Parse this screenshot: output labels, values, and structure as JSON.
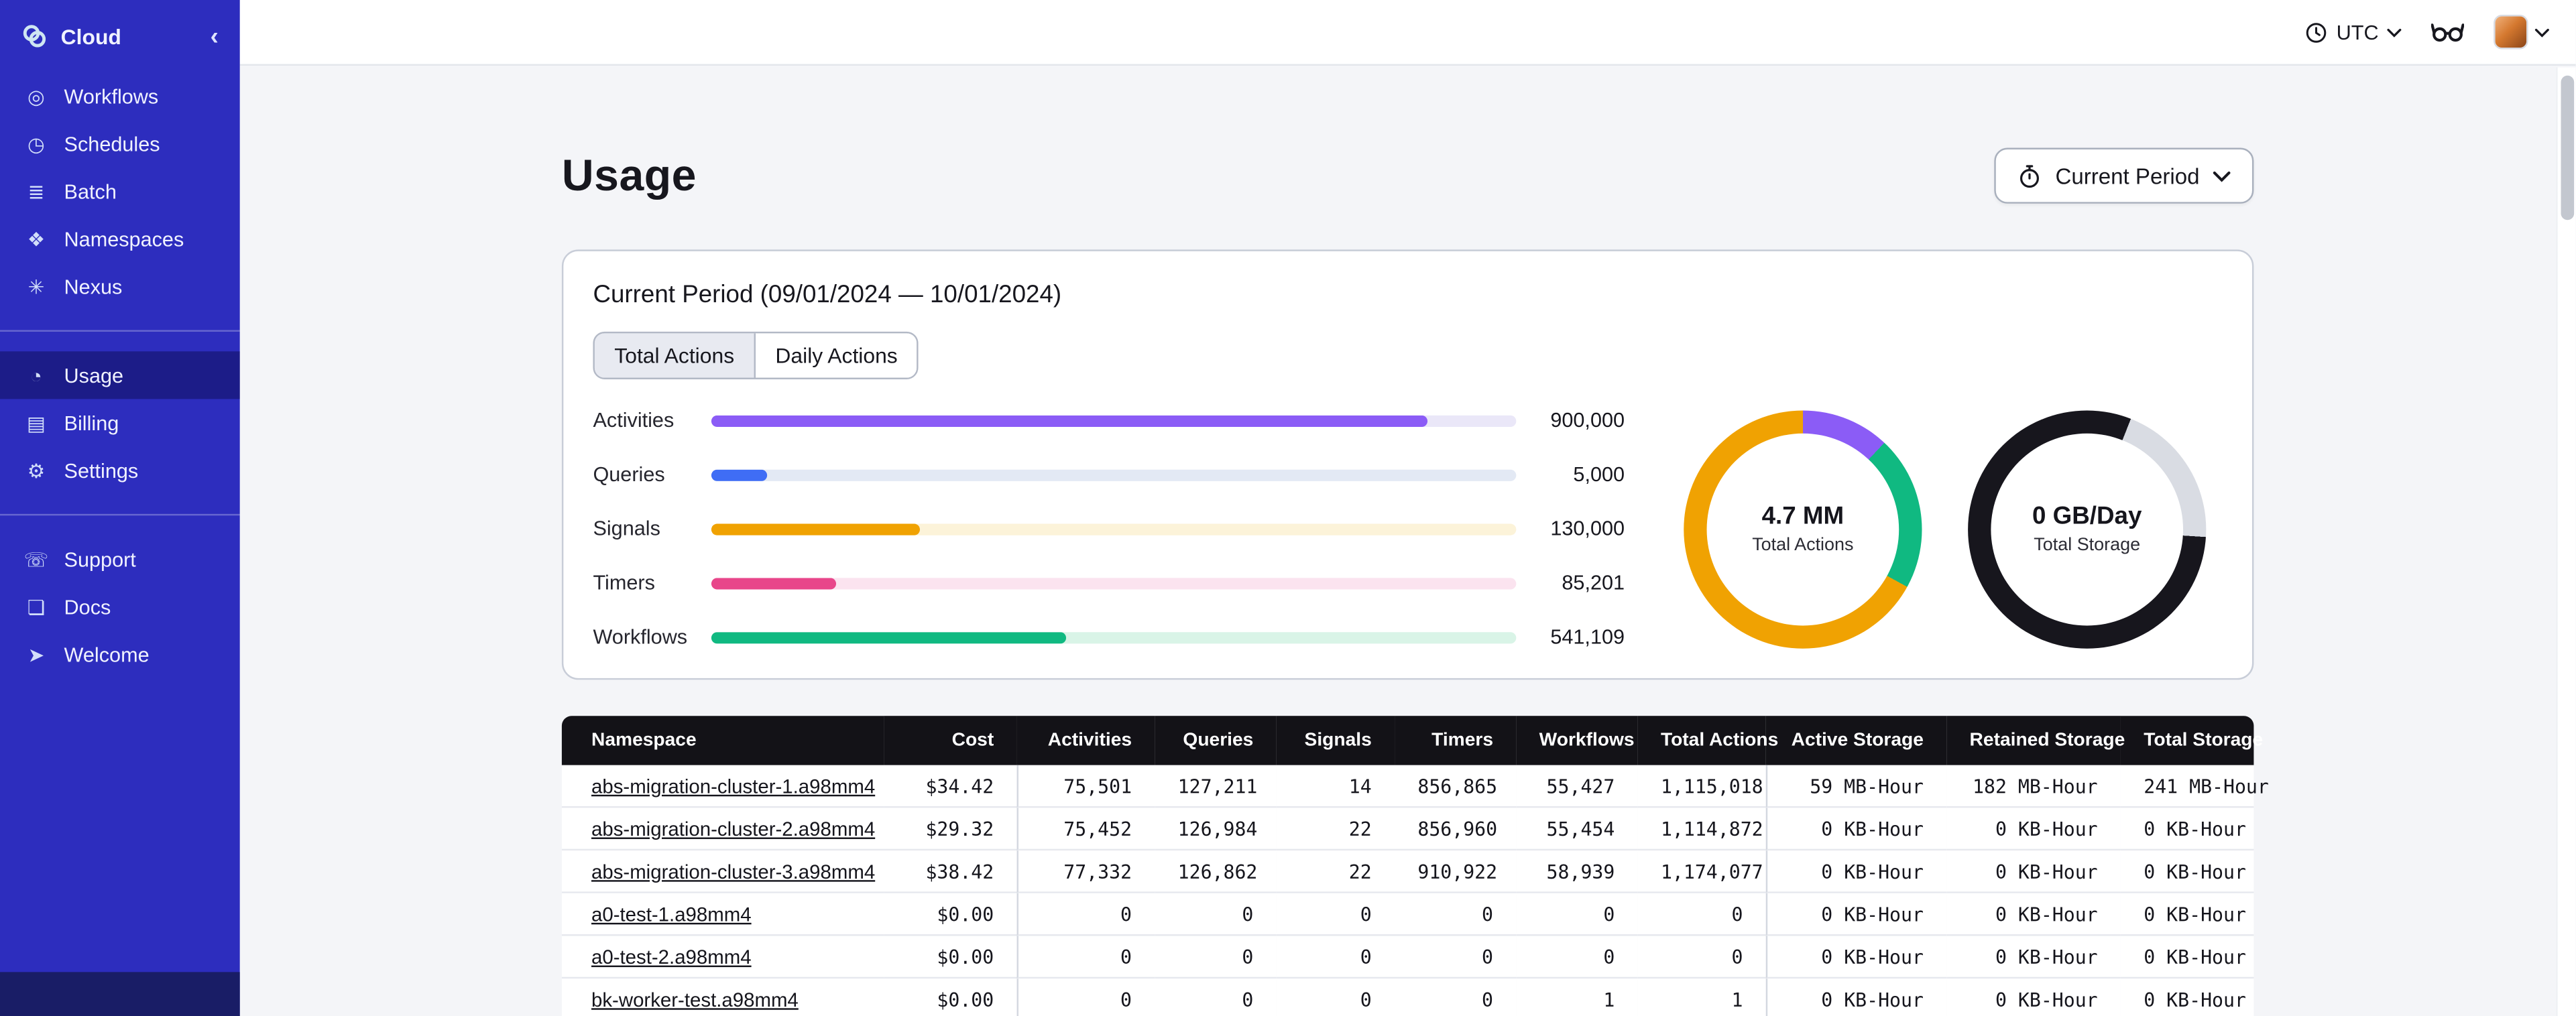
{
  "sidebar": {
    "brand": {
      "label": "Cloud",
      "collapse_glyph": "‹"
    },
    "nav_main": [
      {
        "label": "Workflows",
        "icon": "workflows-icon",
        "glyph": "◎"
      },
      {
        "label": "Schedules",
        "icon": "schedules-icon",
        "glyph": "◷"
      },
      {
        "label": "Batch",
        "icon": "batch-icon",
        "glyph": "≣"
      },
      {
        "label": "Namespaces",
        "icon": "namespaces-icon",
        "glyph": "❖"
      },
      {
        "label": "Nexus",
        "icon": "nexus-icon",
        "glyph": "✳"
      }
    ],
    "nav_account": [
      {
        "label": "Usage",
        "icon": "usage-icon",
        "glyph": "◔",
        "active": true
      },
      {
        "label": "Billing",
        "icon": "billing-icon",
        "glyph": "▤",
        "active": false
      },
      {
        "label": "Settings",
        "icon": "settings-icon",
        "glyph": "⚙",
        "active": false
      }
    ],
    "nav_footer": [
      {
        "label": "Support",
        "icon": "support-icon",
        "glyph": "☏",
        "active": false
      },
      {
        "label": "Docs",
        "icon": "docs-icon",
        "glyph": "❏",
        "active": false
      },
      {
        "label": "Welcome",
        "icon": "welcome-icon",
        "glyph": "➤",
        "active": false
      }
    ]
  },
  "topbar": {
    "timezone_label": "UTC"
  },
  "page": {
    "title": "Usage",
    "period_selector_label": "Current Period"
  },
  "usage_card": {
    "title": "Current Period (09/01/2024 — 10/01/2024)",
    "tabs": [
      {
        "label": "Total Actions",
        "active": true
      },
      {
        "label": "Daily Actions",
        "active": false
      }
    ]
  },
  "chart_data": [
    {
      "type": "bar",
      "orientation": "horizontal",
      "categories": [
        "Activities",
        "Queries",
        "Signals",
        "Timers",
        "Workflows"
      ],
      "values": [
        900000,
        5000,
        130000,
        85201,
        541109
      ],
      "value_labels": [
        "900,000",
        "5,000",
        "130,000",
        "85,201",
        "541,109"
      ],
      "bar_colors": [
        "#8b5cf6",
        "#3f6df5",
        "#f0a202",
        "#e8468a",
        "#10b981"
      ],
      "track_colors": [
        "#eae7f8",
        "#e3e9f4",
        "#fcf3d9",
        "#fbe3ef",
        "#d9f4e7"
      ],
      "fill_pct": [
        89,
        7,
        26,
        15.5,
        44
      ]
    },
    {
      "type": "pie",
      "style": "donut",
      "center_value": "4.7 MM",
      "center_label": "Total Actions",
      "segments": [
        {
          "color": "#8b5cf6",
          "pct": 12
        },
        {
          "color": "#10b981",
          "pct": 21
        },
        {
          "color": "#f0a202",
          "pct": 67
        }
      ]
    },
    {
      "type": "pie",
      "style": "donut",
      "center_value": "0 GB/Day",
      "center_label": "Total Storage",
      "segments": [
        {
          "color": "#17161d",
          "pct": 6
        },
        {
          "color": "#d9dce3",
          "pct": 20
        },
        {
          "color": "#17161d",
          "pct": 74
        }
      ]
    }
  ],
  "table": {
    "columns": [
      "Namespace",
      "Cost",
      "Activities",
      "Queries",
      "Signals",
      "Timers",
      "Workflows",
      "Total Actions",
      "Active Storage",
      "Retained Storage",
      "Total Storage"
    ],
    "rows": [
      [
        "abs-migration-cluster-1.a98mm4",
        "$34.42",
        "75,501",
        "127,211",
        "14",
        "856,865",
        "55,427",
        "1,115,018",
        "59 MB-Hour",
        "182 MB-Hour",
        "241 MB-Hour"
      ],
      [
        "abs-migration-cluster-2.a98mm4",
        "$29.32",
        "75,452",
        "126,984",
        "22",
        "856,960",
        "55,454",
        "1,114,872",
        "0 KB-Hour",
        "0 KB-Hour",
        "0 KB-Hour"
      ],
      [
        "abs-migration-cluster-3.a98mm4",
        "$38.42",
        "77,332",
        "126,862",
        "22",
        "910,922",
        "58,939",
        "1,174,077",
        "0 KB-Hour",
        "0 KB-Hour",
        "0 KB-Hour"
      ],
      [
        "a0-test-1.a98mm4",
        "$0.00",
        "0",
        "0",
        "0",
        "0",
        "0",
        "0",
        "0 KB-Hour",
        "0 KB-Hour",
        "0 KB-Hour"
      ],
      [
        "a0-test-2.a98mm4",
        "$0.00",
        "0",
        "0",
        "0",
        "0",
        "0",
        "0",
        "0 KB-Hour",
        "0 KB-Hour",
        "0 KB-Hour"
      ],
      [
        "bk-worker-test.a98mm4",
        "$0.00",
        "0",
        "0",
        "0",
        "0",
        "1",
        "1",
        "0 KB-Hour",
        "0 KB-Hour",
        "0 KB-Hour"
      ]
    ]
  }
}
